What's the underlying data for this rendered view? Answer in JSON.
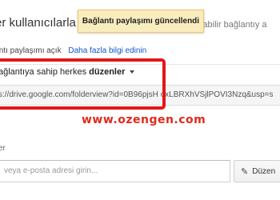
{
  "header": {
    "title_fragment": "er kullanıcılarla pa",
    "title_cut_text": "şilabilir bağlantıy a"
  },
  "toast": {
    "message": "Bağlantı paylaşımı güncellendi"
  },
  "link_sharing": {
    "status_text": "ıntı paylaşımı açık",
    "learn_more": "Daha fazla bilgi edinin"
  },
  "access": {
    "prefix": "ağlantıya sahip herkes ",
    "level": "düzenler",
    "dropdown_icon": "caret-down-icon"
  },
  "share_link": {
    "url": "s://drive.google.com/folderview?id=0B96pjsH oxLBRXhVSjlPOVI3Nzq&usp=s"
  },
  "watermark": {
    "text": "www.ozengen.com"
  },
  "invite": {
    "section_label": "er",
    "email_placeholder": "veya e-posta adresi girin...",
    "permission_label": "Düzen",
    "permission_icon": "pencil-icon"
  },
  "colors": {
    "toast_bg": "#f9edbe",
    "link": "#1155cc",
    "highlight_border": "#e01818",
    "watermark": "#e02a1a"
  }
}
